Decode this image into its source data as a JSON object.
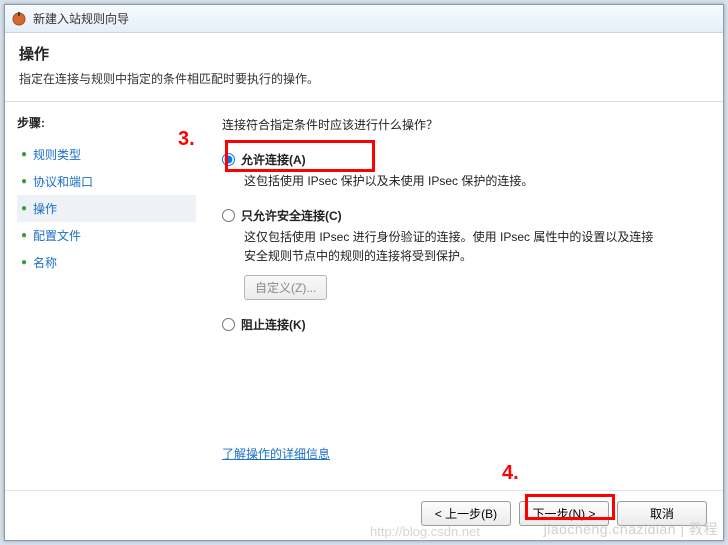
{
  "window": {
    "title": "新建入站规则向导"
  },
  "header": {
    "title": "操作",
    "desc": "指定在连接与规则中指定的条件相匹配时要执行的操作。"
  },
  "sidebar": {
    "steps_label": "步骤:",
    "items": [
      {
        "label": "规则类型"
      },
      {
        "label": "协议和端口"
      },
      {
        "label": "操作"
      },
      {
        "label": "配置文件"
      },
      {
        "label": "名称"
      }
    ]
  },
  "main": {
    "question": "连接符合指定条件时应该进行什么操作？",
    "options": [
      {
        "label": "允许连接(A)",
        "desc": "这包括使用 IPsec 保护以及未使用 IPsec 保护的连接。",
        "checked": true
      },
      {
        "label": "只允许安全连接(C)",
        "desc": "这仅包括使用 IPsec 进行身份验证的连接。使用 IPsec 属性中的设置以及连接安全规则节点中的规则的连接将受到保护。",
        "checked": false,
        "custom_btn": "自定义(Z)..."
      },
      {
        "label": "阻止连接(K)",
        "desc": "",
        "checked": false
      }
    ],
    "link": "了解操作的详细信息"
  },
  "buttons": {
    "back": "< 上一步(B)",
    "next": "下一步(N) >",
    "cancel": "取消"
  },
  "annotations": {
    "a3": "3.",
    "a4": "4."
  },
  "watermark": {
    "right": "jiaocheng.chazidian | 教程",
    "left": "http://blog.csdn.net"
  }
}
